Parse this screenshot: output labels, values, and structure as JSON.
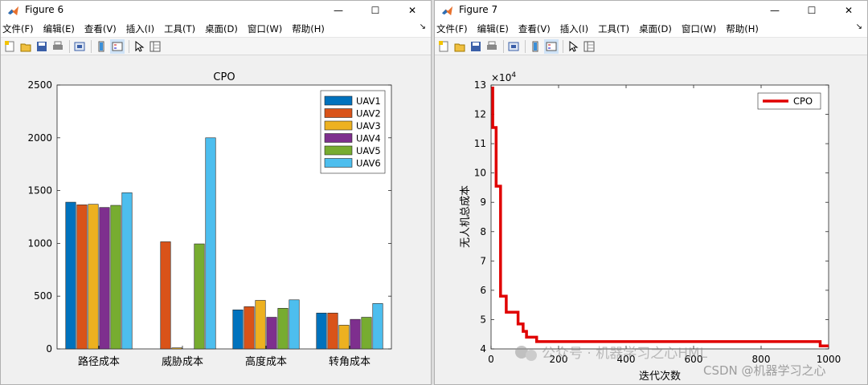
{
  "figure6": {
    "title": "Figure 6",
    "menu": [
      "文件(F)",
      "编辑(E)",
      "查看(V)",
      "插入(I)",
      "工具(T)",
      "桌面(D)",
      "窗口(W)",
      "帮助(H)"
    ],
    "toolbar_icons": [
      "new-file-icon",
      "open-folder-icon",
      "save-icon",
      "print-icon",
      "link-plot-icon",
      "insert-colorbar-icon",
      "insert-legend-icon",
      "pointer-icon",
      "property-editor-icon"
    ]
  },
  "figure7": {
    "title": "Figure 7",
    "menu": [
      "文件(F)",
      "编辑(E)",
      "查看(V)",
      "插入(I)",
      "工具(T)",
      "桌面(D)",
      "窗口(W)",
      "帮助(H)"
    ],
    "toolbar_icons": [
      "new-file-icon",
      "open-folder-icon",
      "save-icon",
      "print-icon",
      "link-plot-icon",
      "insert-colorbar-icon",
      "insert-legend-icon",
      "pointer-icon",
      "property-editor-icon"
    ]
  },
  "window_controls": {
    "minimize": "—",
    "maximize": "☐",
    "close": "✕"
  },
  "chart_data": [
    {
      "type": "bar",
      "title": "CPO",
      "categories": [
        "路径成本",
        "威胁成本",
        "高度成本",
        "转角成本"
      ],
      "ylim": [
        0,
        2500
      ],
      "yticks": [
        0,
        500,
        1000,
        1500,
        2000,
        2500
      ],
      "legend_position": "top-right",
      "series": [
        {
          "name": "UAV1",
          "color": "#0072BD",
          "values": [
            1390,
            0,
            370,
            340
          ]
        },
        {
          "name": "UAV2",
          "color": "#D95319",
          "values": [
            1365,
            1015,
            400,
            340
          ]
        },
        {
          "name": "UAV3",
          "color": "#EDB120",
          "values": [
            1370,
            10,
            460,
            225
          ]
        },
        {
          "name": "UAV4",
          "color": "#7E2F8E",
          "values": [
            1340,
            0,
            300,
            280
          ]
        },
        {
          "name": "UAV5",
          "color": "#77AC30",
          "values": [
            1360,
            995,
            385,
            300
          ]
        },
        {
          "name": "UAV6",
          "color": "#4DBEEE",
          "values": [
            1480,
            2000,
            465,
            430
          ]
        }
      ]
    },
    {
      "type": "line",
      "xlabel": "迭代次数",
      "ylabel": "无人机总成本",
      "exponent_label": "×10",
      "exponent_power": "4",
      "xlim": [
        0,
        1000
      ],
      "ylim": [
        4,
        13
      ],
      "xticks": [
        0,
        200,
        400,
        600,
        800,
        1000
      ],
      "yticks": [
        4,
        5,
        6,
        7,
        8,
        9,
        10,
        11,
        12,
        13
      ],
      "legend_position": "top-right",
      "series": [
        {
          "name": "CPO",
          "color": "#E00000",
          "x": [
            1,
            5,
            5,
            15,
            15,
            28,
            28,
            45,
            45,
            80,
            80,
            95,
            95,
            105,
            105,
            135,
            135,
            975,
            975,
            1000
          ],
          "y": [
            12.9,
            12.9,
            11.55,
            11.55,
            9.55,
            9.55,
            5.8,
            5.8,
            5.25,
            5.25,
            4.85,
            4.85,
            4.6,
            4.6,
            4.4,
            4.4,
            4.25,
            4.25,
            4.1,
            4.1
          ]
        }
      ]
    }
  ],
  "watermarks": {
    "wechat": "公众号 · 机器学习之心HML",
    "csdn": "CSDN @机器学习之心"
  }
}
